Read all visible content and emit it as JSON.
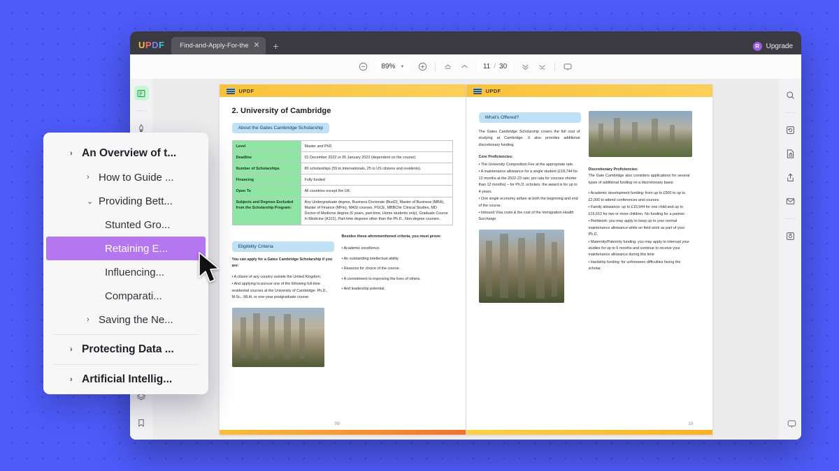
{
  "window": {
    "logo": "UPDF",
    "tab_title": "Find-and-Apply-For-the-B",
    "tab_close": "✕",
    "tab_add": "+",
    "upgrade_label": "Upgrade",
    "upgrade_badge": "R"
  },
  "toolbar": {
    "zoom_out_icon": "zoom-out-icon",
    "zoom_value": "89%",
    "zoom_in_icon": "zoom-in-icon",
    "first_page_icon": "first-page-icon",
    "prev_page_icon": "previous-page-icon",
    "current_page": "11",
    "page_separator": "/",
    "total_pages": "30",
    "next_page_icon": "next-page-icon",
    "last_page_icon": "last-page-icon",
    "comment_icon": "comment-icon"
  },
  "rail_left": {
    "items": [
      {
        "name": "reader-mode-icon",
        "active": true
      },
      {
        "name": "highlighter-icon",
        "active": false
      },
      {
        "name": "annotate-icon",
        "active": false
      }
    ],
    "bottom": [
      {
        "name": "layers-icon"
      },
      {
        "name": "bookmark-icon"
      }
    ]
  },
  "rail_right": {
    "items": [
      {
        "name": "search-icon"
      },
      {
        "name": "convert-icon"
      },
      {
        "name": "protect-icon"
      },
      {
        "name": "share-icon"
      },
      {
        "name": "email-icon"
      },
      {
        "name": "compress-icon"
      }
    ]
  },
  "outline": {
    "items": [
      {
        "label": "An Overview of t...",
        "level": 1,
        "chevron": "›",
        "selected": false
      },
      {
        "label": "How to Guide ...",
        "level": 2,
        "chevron": "›",
        "selected": false
      },
      {
        "label": "Providing Bett...",
        "level": 2,
        "chevron": "⌄",
        "selected": false
      },
      {
        "label": "Stunted Gro...",
        "level": 3,
        "chevron": "",
        "selected": false
      },
      {
        "label": "Retaining E...",
        "level": 3,
        "chevron": "",
        "selected": true
      },
      {
        "label": "Influencing...",
        "level": 3,
        "chevron": "",
        "selected": false
      },
      {
        "label": "Comparati...",
        "level": 3,
        "chevron": "",
        "selected": false
      },
      {
        "label": "Saving the Ne...",
        "level": 2,
        "chevron": "›",
        "selected": false
      },
      {
        "label": "Protecting Data ...",
        "level": 1,
        "chevron": "›",
        "selected": false
      },
      {
        "label": "Artificial Intellig...",
        "level": 1,
        "chevron": "›",
        "selected": false
      }
    ]
  },
  "page_left": {
    "band_label": "UPDF",
    "page_number": "09",
    "heading": "2.  University of Cambridge",
    "pill": "About the Gates Cambridge Scholarship",
    "table": {
      "rows": [
        {
          "key": "Level",
          "value": "Master and PhD"
        },
        {
          "key": "Deadline",
          "value": "01 December 2022 or 05 January 2023 (dependent on the course)."
        },
        {
          "key": "Number of Scholarships",
          "value": "80 scholarships (55 to internationals, 25 to US citizens and residents)."
        },
        {
          "key": "Financing",
          "value": "Fully funded"
        },
        {
          "key": "Open To",
          "value": "All countries except the UK."
        },
        {
          "key": "Subjects and Degrees Excluded from the Scholarship Program:",
          "value": "Any Undergraduate degree, Business Doctorate (BusD), Master of Business (MBA), Master of Finance (MFin), MASt courses, PGCE, MBBChir Clinical Studies, MD Doctor of Medicine degree (6 years, part-time, Home students only), Graduate Course in Medicine (A101), Part-time degrees other than the Ph.D., Non-degree courses."
        }
      ]
    },
    "eligibility": {
      "pill": "Eligibility Criteria",
      "intro": "You can apply for a Gates Cambridge Scholarship if you are:",
      "bullets": [
        "• A citizen of any country outside the United Kingdom.",
        "• And applying to pursue one of the following full-time residential courses at the University of Cambridge: Ph.D., M.Sc., MLitt, or one-year postgraduate course."
      ]
    },
    "besides": {
      "intro": "Besides these aforementioned criteria, you must prove:",
      "bullets": [
        "• Academic excellence.",
        "• An outstanding intellectual ability.",
        "• Reasons for choice of the course.",
        "• A commitment to improving the lives of others.",
        "• And leadership potential."
      ]
    }
  },
  "page_right": {
    "band_label": "UPDF",
    "page_number": "10",
    "offered": {
      "pill": "What's Offered?",
      "intro": "The Gates Cambridge Scholarship covers the full cost of studying at Cambridge. It also provides additional discretionary funding.",
      "core_title": "Core Proficiencies:",
      "core_bullets": [
        "• The University Composition Fee at the appropriate rate.",
        "• A maintenance allowance for a single student (£18,744 for 12 months at the 2022-23 rate; pro rata for courses shorter than 12 months) – for Ph.D. scholars, the award is for up to 4 years.",
        "• One single economy airfare at both the beginning and end of the course.",
        "• Inbound Visa costs & the cost of the Immigration Health Surcharge."
      ]
    },
    "discretionary": {
      "title": "Discretionary Proficiencies:",
      "intro": "The Gate Cambridge also considers applications for several types of additional funding on a discretionary basis:",
      "bullets": [
        "• Academic development funding: from up to £500 to up to £2,000 to attend conferences and courses.",
        "• Family allowance: up to £10,944 for one child and up to £15,612 for two or more children. No funding for a partner.",
        "• Fieldwork: you may apply to keep up to your normal maintenance allowance while on field work as part of your Ph.D.",
        "• Maternity/Paternity funding: you may apply to interrupt your studies for up to 6 months and continue to receive your maintenance allowance during this time",
        "• Hardship funding: for unforeseen difficulties facing the scholar."
      ]
    }
  },
  "colors": {
    "background": "#4d5bf9",
    "accent_purple": "#b577f0",
    "band_yellow": "#f9c23c",
    "table_green": "#8fe6a4",
    "pill_blue": "#bfe0f5"
  }
}
